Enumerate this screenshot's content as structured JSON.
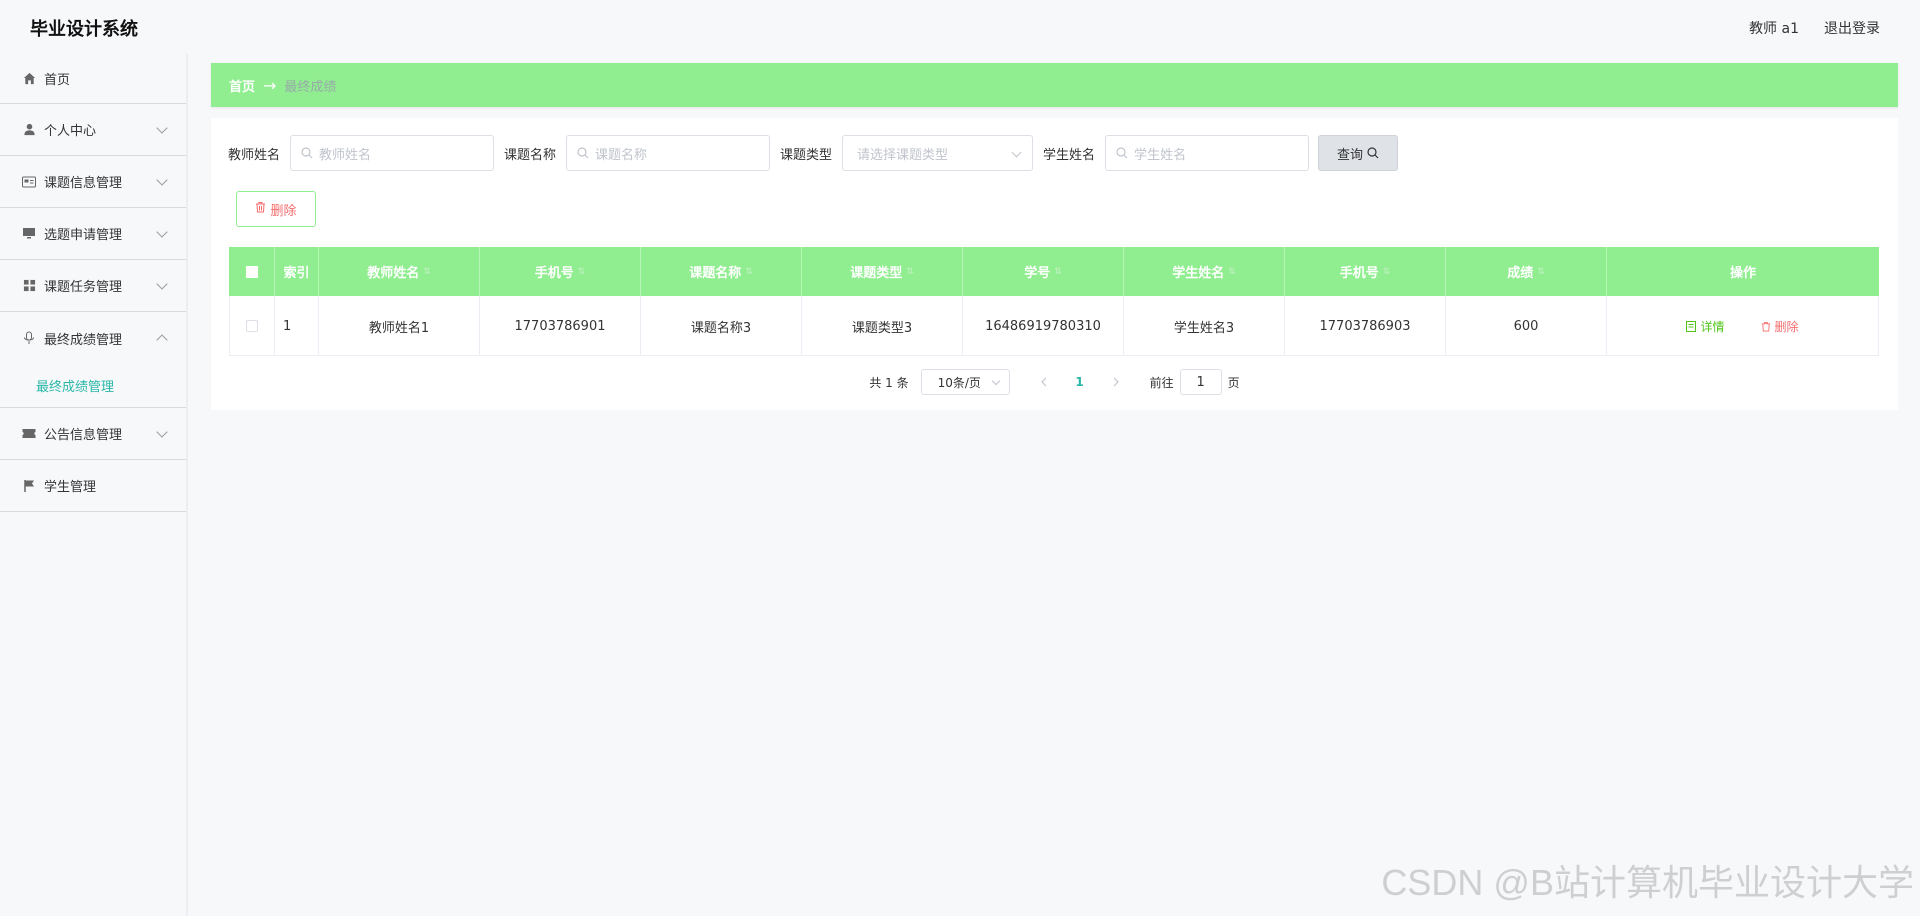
{
  "app": {
    "title": "毕业设计系统",
    "user": "教师 a1",
    "logout": "退出登录"
  },
  "sidebar": {
    "items": [
      {
        "label": "首页",
        "icon": "home-icon",
        "has_chevron": false
      },
      {
        "label": "个人中心",
        "icon": "user-icon",
        "has_chevron": true
      },
      {
        "label": "课题信息管理",
        "icon": "id-card-icon",
        "has_chevron": true
      },
      {
        "label": "选题申请管理",
        "icon": "monitor-icon",
        "has_chevron": true
      },
      {
        "label": "课题任务管理",
        "icon": "grid-icon",
        "has_chevron": true
      },
      {
        "label": "最终成绩管理",
        "icon": "microphone-icon",
        "has_chevron": true,
        "expanded": true
      },
      {
        "label": "公告信息管理",
        "icon": "ticket-icon",
        "has_chevron": true
      },
      {
        "label": "学生管理",
        "icon": "flag-icon",
        "has_chevron": false
      }
    ],
    "submenu_active": "最终成绩管理"
  },
  "breadcrumb": {
    "home": "首页",
    "separator": "→",
    "current": "最终成绩"
  },
  "search": {
    "teacher_label": "教师姓名",
    "teacher_placeholder": "教师姓名",
    "topic_label": "课题名称",
    "topic_placeholder": "课题名称",
    "type_label": "课题类型",
    "type_placeholder": "请选择课题类型",
    "student_label": "学生姓名",
    "student_placeholder": "学生姓名",
    "query_label": "查询"
  },
  "toolbar": {
    "delete_label": "删除"
  },
  "table": {
    "headers": [
      "索引",
      "教师姓名",
      "手机号",
      "课题名称",
      "课题类型",
      "学号",
      "学生姓名",
      "手机号",
      "成绩",
      "操作"
    ],
    "rows": [
      {
        "index": "1",
        "teacher_name": "教师姓名1",
        "teacher_phone": "17703786901",
        "topic_name": "课题名称3",
        "topic_type": "课题类型3",
        "student_no": "16486919780310",
        "student_name": "学生姓名3",
        "student_phone": "17703786903",
        "score": "600",
        "detail_label": "详情",
        "delete_label": "删除"
      }
    ]
  },
  "pagination": {
    "total": "共 1 条",
    "page_size": "10条/页",
    "current_page": "1",
    "goto_prefix": "前往",
    "goto_value": "1",
    "goto_suffix": "页"
  },
  "watermark": "CSDN @B站计算机毕业设计大学",
  "colors": {
    "accent_green": "#90ee90",
    "active_teal": "#2bb7a8",
    "danger": "#f56c6c",
    "success": "#52c41a"
  }
}
